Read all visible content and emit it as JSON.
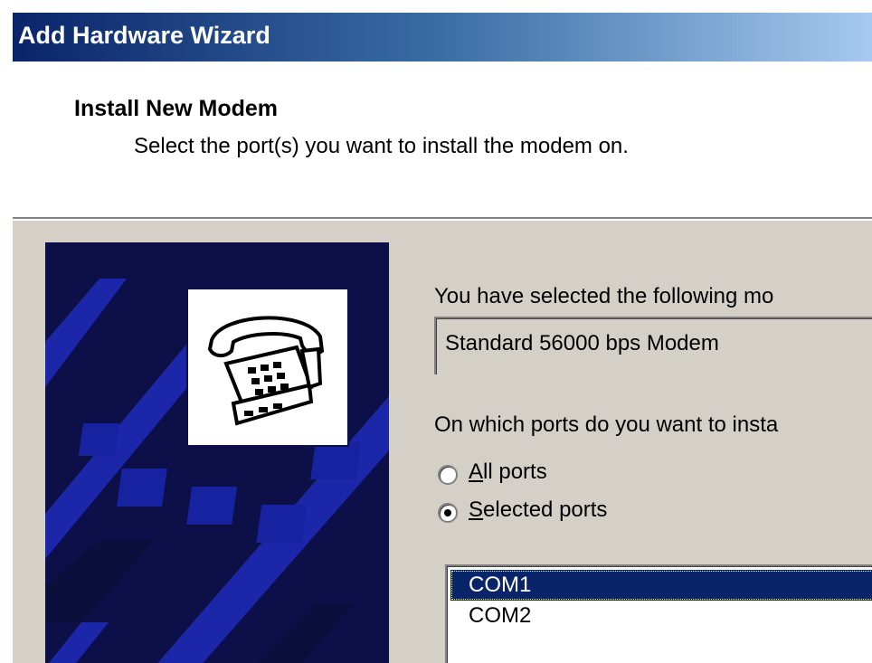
{
  "window": {
    "title": "Add Hardware Wizard"
  },
  "header": {
    "title": "Install New Modem",
    "subtitle": "Select the port(s) you want to install the modem on."
  },
  "banner": {
    "icon": "telephone-icon"
  },
  "content": {
    "selected_label": "You have selected the following mo",
    "modem_name": "Standard 56000 bps Modem",
    "ports_question": "On which ports do you want to insta",
    "radio_all": {
      "accel": "A",
      "rest": "ll ports",
      "checked": false
    },
    "radio_selected": {
      "accel": "S",
      "rest": "elected ports",
      "checked": true
    },
    "ports": [
      {
        "name": "COM1",
        "selected": true
      },
      {
        "name": "COM2",
        "selected": false
      }
    ]
  },
  "colors": {
    "selection": "#0a246a",
    "dialog_face": "#d4d0c8",
    "banner_bg": "#0d1048",
    "banner_tiles": "#1b27a8"
  }
}
